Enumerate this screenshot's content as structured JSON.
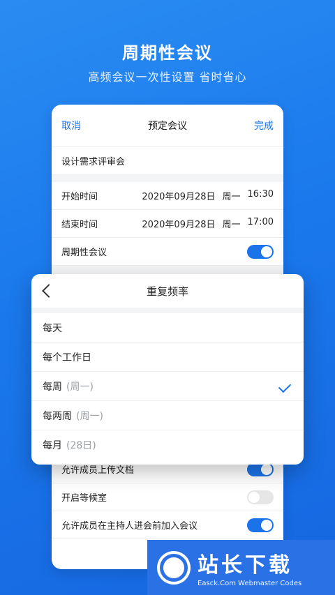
{
  "hero": {
    "title": "周期性会议",
    "subtitle": "高频会议一次性设置 省时省心"
  },
  "schedule_card": {
    "nav_left": "取消",
    "nav_title": "预定会议",
    "nav_right": "完成",
    "meeting_name": "设计需求评审会",
    "start_label": "开始时间",
    "start_date": "2020年09月28日",
    "start_week": "周一",
    "start_time": "16:30",
    "end_label": "结束时间",
    "end_date": "2020年09月28日",
    "end_week": "周一",
    "end_time": "17:00",
    "recurring_label": "周期性会议",
    "recurring_on": true,
    "allow_upload_label": "允许成员上传文档",
    "allow_upload_on": true,
    "waiting_room_label": "开启等候室",
    "waiting_room_on": false,
    "join_before_host_label": "允许成员在主持人进会前加入会议",
    "join_before_host_on": true
  },
  "repeat_sheet": {
    "title": "重复频率",
    "options": [
      {
        "label": "每天",
        "sub": ""
      },
      {
        "label": "每个工作日",
        "sub": ""
      },
      {
        "label": "每周",
        "sub": "(周一)",
        "selected": true
      },
      {
        "label": "每两周",
        "sub": "(周一)"
      },
      {
        "label": "每月",
        "sub": "(28日)"
      }
    ]
  },
  "watermark": {
    "brand": "站长下载",
    "url_text": "Easck.Com Webmaster Codes"
  },
  "colors": {
    "accent": "#1a73e8",
    "background": "#1a78ec",
    "toggle_off": "#e6e6e6"
  }
}
